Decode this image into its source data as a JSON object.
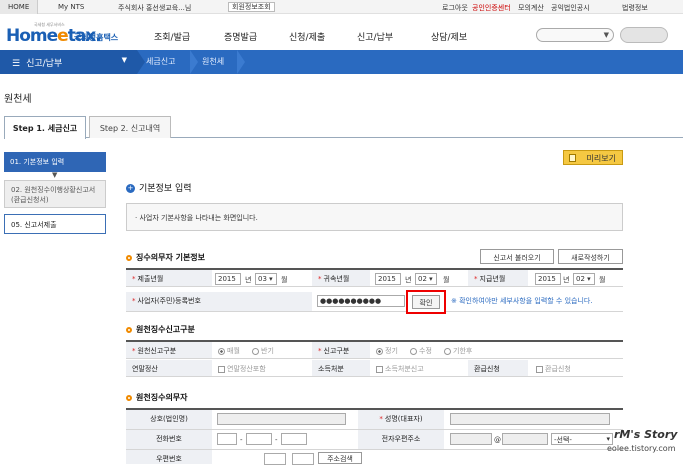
{
  "topbar": {
    "home": "HOME",
    "my_nts": "My NTS",
    "company": "주식회사  홍선생교육...님",
    "member_info": "회원정보조회",
    "logout": "로그아웃",
    "cert_center": "공인인증센터",
    "mock_calc": "모의계산",
    "public_corp": "공익법인공시",
    "law_info": "법령정보"
  },
  "header": {
    "logo_text_a": "Home",
    "logo_text_e": "e",
    "logo_text_b": "tax.",
    "logo_sub": "국세청홈택스",
    "logo_tiny": "국세청 세무서비스",
    "nav": [
      "조회/발급",
      "증명발급",
      "신청/제출",
      "신고/납부",
      "상담/제보"
    ]
  },
  "navbar": {
    "menu_label": "신고/납부",
    "crumbs": [
      "세금신고",
      "원천세"
    ]
  },
  "page": {
    "title": "원천세",
    "tabs": [
      "Step 1. 세금신고",
      "Step 2. 신고내역"
    ],
    "preview_label": "미리보기"
  },
  "sidebar": {
    "items": [
      "01. 기본정보 입력",
      "02. 원천징수이행상황신고서(환급신청서)",
      "05. 신고서제출"
    ]
  },
  "main": {
    "section_title": "기본정보 입력",
    "info_text": "사업자 기본사항을 나타내는 화면입니다.",
    "group1": {
      "title": "징수의무자 기본정보",
      "btn_load": "신고서 불러오기",
      "btn_new": "새로작성하기",
      "label_submit_ym": "제출년월",
      "label_belong_ym": "귀속년월",
      "label_pay_ym": "지급년월",
      "submit_year": "2015",
      "submit_month": "03",
      "belong_year": "2015",
      "belong_month": "02",
      "pay_year": "2015",
      "pay_month": "02",
      "year_unit": "년",
      "month_unit": "월",
      "label_bizno": "사업자(주민)등록번호",
      "bizno_value": "●●●●●●●●●●",
      "confirm_label": "확인",
      "hint": "※ 확인하여야만 세부사항을 입력할 수 있습니다."
    },
    "group2": {
      "title": "원천징수신고구분",
      "label_type": "원천신고구분",
      "type_options": [
        "매월",
        "반기"
      ],
      "label_report": "신고구분",
      "report_options": [
        "정기",
        "수정",
        "기한후"
      ],
      "label_yearend": "연말정산",
      "yearend_opt": "연말정산포함",
      "label_income": "소득처분",
      "income_opt": "소득처분신고",
      "label_refund": "환급신청",
      "refund_opt": "환급신청"
    },
    "group3": {
      "title": "원천징수의무자",
      "label_company": "상호(법인명)",
      "label_rep": "성명(대표자)",
      "label_phone": "전화번호",
      "label_email": "전자우편주소",
      "email_select": "-선택-",
      "label_zip": "우편번호",
      "zip_btn": "주소검색",
      "dash": "-",
      "at": "@"
    }
  },
  "watermark": {
    "line1": "rM's Story",
    "line2": "eolee.tistory.com"
  }
}
